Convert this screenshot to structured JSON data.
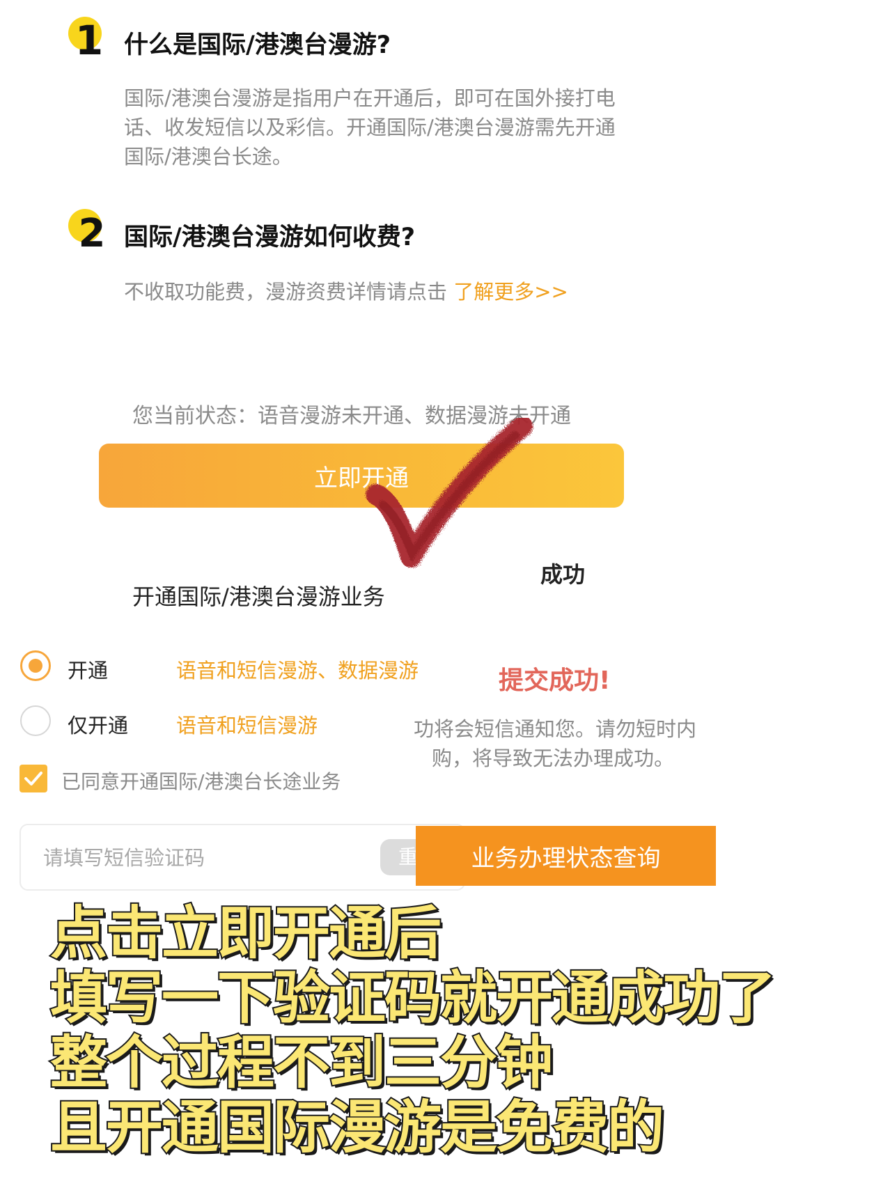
{
  "faq": [
    {
      "number": "1",
      "question": "什么是国际/港澳台漫游?",
      "answer_lines": [
        "国际/港澳台漫游是指用户在开通后，即可在国外接打电",
        "话、收发短信以及彩信。开通国际/港澳台漫游需先开通",
        "国际/港澳台长途。"
      ]
    },
    {
      "number": "2",
      "question": "国际/港澳台漫游如何收费?",
      "answer_text": "不收取功能费，漫游资费详情请点击",
      "answer_link": "了解更多>>"
    }
  ],
  "status_text": "您当前状态：语音漫游未开通、数据漫游未开通",
  "open_button_label": "立即开通",
  "overlay": {
    "service_text": "开通国际/港澳台漫游业务",
    "success_text": "成功"
  },
  "options": [
    {
      "label": "开通",
      "description": "语音和短信漫游、数据漫游",
      "selected": true
    },
    {
      "label": "仅开通",
      "description": "语音和短信漫游",
      "selected": false
    }
  ],
  "submit_success": "提交成功!",
  "notice_lines": [
    "功将会短信通知您。请勿短时内",
    "购，将导致无法办理成功。"
  ],
  "agreement": {
    "checked": true,
    "label": "已同意开通国际/港澳台长途业务"
  },
  "sms_code": {
    "placeholder": "请填写短信验证码",
    "value": "",
    "resend_label": "重"
  },
  "query_button_label": "业务办理状态查询",
  "caption_lines": [
    "点击立即开通后",
    "填写一下验证码就开通成功了",
    "整个过程不到三分钟",
    "且开通国际漫游是免费的"
  ],
  "colors": {
    "accent": "#f9b838",
    "link": "#f0a01e",
    "query_button": "#f5931f",
    "success_red": "#e2665a",
    "checkmark": "#a8262e",
    "badge_yellow": "#f8d51c",
    "caption_fill": "#fbe774"
  }
}
